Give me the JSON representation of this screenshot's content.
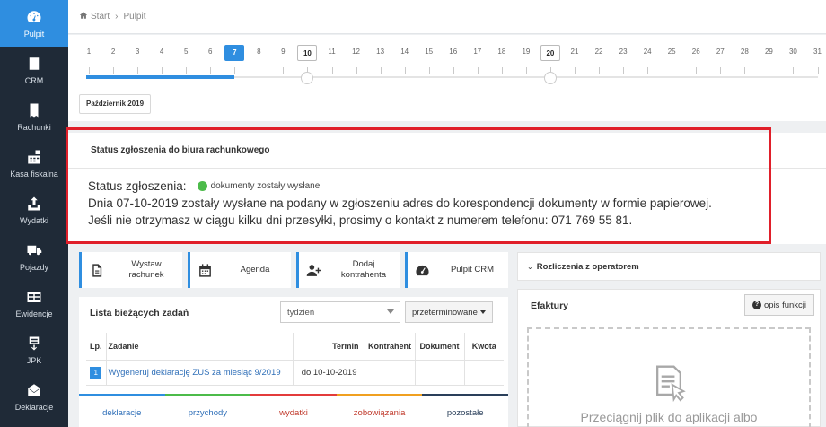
{
  "sidebar": {
    "items": [
      {
        "label": "Pulpit",
        "icon": "dashboard-icon"
      },
      {
        "label": "CRM",
        "icon": "crm-book-icon"
      },
      {
        "label": "Rachunki",
        "icon": "receipt-icon"
      },
      {
        "label": "Kasa fiskalna",
        "icon": "cash-register-icon"
      },
      {
        "label": "Wydatki",
        "icon": "upload-icon"
      },
      {
        "label": "Pojazdy",
        "icon": "truck-icon"
      },
      {
        "label": "Ewidencje",
        "icon": "table-icon"
      },
      {
        "label": "JPK",
        "icon": "jpk-file-icon"
      },
      {
        "label": "Deklaracje",
        "icon": "envelope-icon"
      }
    ]
  },
  "breadcrumb": {
    "home": "Start",
    "current": "Pulpit"
  },
  "timeline": {
    "days": [
      "1",
      "2",
      "3",
      "4",
      "5",
      "6",
      "7",
      "8",
      "9",
      "10",
      "11",
      "12",
      "13",
      "14",
      "15",
      "16",
      "17",
      "18",
      "19",
      "20",
      "21",
      "22",
      "23",
      "24",
      "25",
      "26",
      "27",
      "28",
      "29",
      "30",
      "31"
    ],
    "current_day": "7",
    "marked_days": [
      "10",
      "20"
    ],
    "month_label": "Październik 2019"
  },
  "status": {
    "title": "Status zgłoszenia do biura rachunkowego",
    "label": "Status zgłoszenia:",
    "state": "dokumenty zostały wysłane",
    "line2": "Dnia 07-10-2019 zostały wysłane na podany w zgłoszeniu adres do korespondencji dokumenty w formie papierowej.",
    "line3": "Jeśli nie otrzymasz w ciągu kilku dni przesyłki, prosimy o kontakt z numerem telefonu: 071 769 55 81.",
    "state_color": "#4cbb4a"
  },
  "quick_actions": [
    {
      "label1": "Wystaw",
      "label2": "rachunek",
      "icon": "document-icon"
    },
    {
      "label1": "Agenda",
      "label2": "",
      "icon": "calendar-icon"
    },
    {
      "label1": "Dodaj",
      "label2": "kontrahenta",
      "icon": "add-user-icon"
    },
    {
      "label1": "Pulpit CRM",
      "label2": "",
      "icon": "speedometer-icon"
    }
  ],
  "rozliczenia": {
    "title": "Rozliczenia z operatorem"
  },
  "tasks": {
    "title": "Lista bieżących zadań",
    "period_select": "tydzień",
    "filter_button": "przeterminowane",
    "columns": [
      "Lp.",
      "Zadanie",
      "Termin",
      "Kontrahent",
      "Dokument",
      "Kwota"
    ],
    "rows": [
      {
        "lp": "1",
        "task": "Wygeneruj deklarację ZUS za miesiąc 9/2019",
        "due": "do 10-10-2019",
        "contractor": "",
        "document": "",
        "amount": ""
      }
    ],
    "tabs": [
      {
        "label": "deklaracje",
        "color": "#2f8ee0"
      },
      {
        "label": "przychody",
        "color": "#4cbb4a"
      },
      {
        "label": "wydatki",
        "color": "#e33b3b"
      },
      {
        "label": "zobowiązania",
        "color": "#f0a020"
      },
      {
        "label": "pozostałe",
        "color": "#2a3f5a"
      }
    ]
  },
  "efaktury": {
    "title": "Efaktury",
    "help_button": "opis funkcji",
    "drop_text": "Przeciągnij plik do aplikacji albo"
  },
  "colors": {
    "accent": "#2f8ee0",
    "sidebar_bg": "#1f2a37",
    "highlight_frame": "#e01f2a"
  }
}
